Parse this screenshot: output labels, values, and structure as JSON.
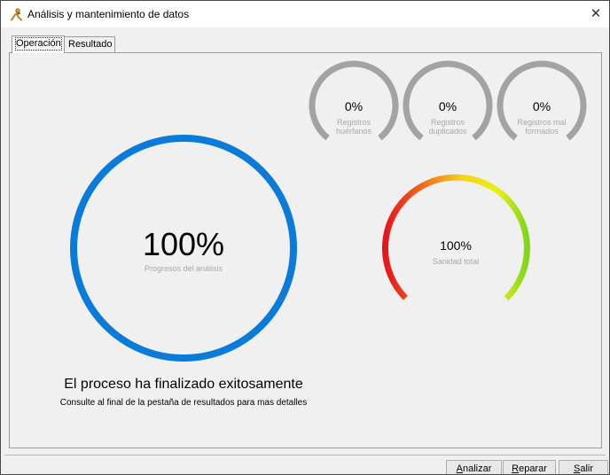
{
  "window": {
    "title": "Análisis y mantenimiento de datos",
    "close_glyph": "✕"
  },
  "tabs": [
    {
      "label": "Operación",
      "active": true
    },
    {
      "label": "Resultado",
      "active": false
    }
  ],
  "small_gauges": [
    {
      "value": "0%",
      "label_line1": "Registros",
      "label_line2": "huérfanos",
      "level": 0
    },
    {
      "value": "0%",
      "label_line1": "Registros",
      "label_line2": "duplicados",
      "level": 0
    },
    {
      "value": "0%",
      "label_line1": "Registros mal",
      "label_line2": "formados",
      "level": 0
    }
  ],
  "progress_gauge": {
    "value": "100%",
    "label": "Progresos del análisis",
    "level": 1.0,
    "color": "#0a7bd9"
  },
  "health_gauge": {
    "value": "100%",
    "label": "Sanidad total",
    "level": 1.0
  },
  "status": {
    "title": "El proceso ha finalizado exitosamente",
    "detail": "Consulte al final de la pestaña de resultados para mas detalles"
  },
  "buttons": {
    "analizar": {
      "mnemonic": "A",
      "rest": "nalizar"
    },
    "reparar": {
      "mnemonic": "R",
      "rest": "eparar"
    },
    "salir": {
      "mnemonic": "S",
      "rest": "alir"
    }
  },
  "colors": {
    "gauge_gray": "#a3a3a3",
    "label_gray": "#a8a8a8",
    "accent_blue": "#0a7bd9"
  },
  "icons": {
    "app": "person-figure-icon",
    "close": "close-icon"
  }
}
